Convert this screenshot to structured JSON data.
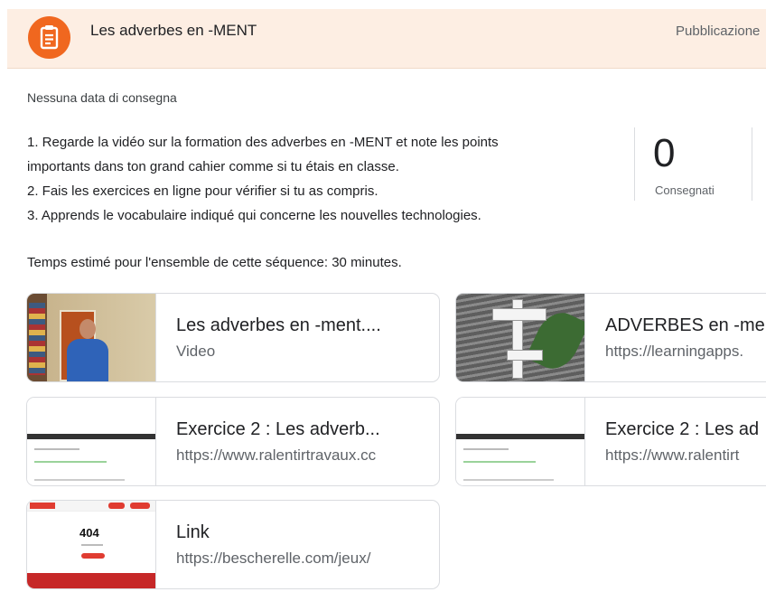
{
  "header": {
    "title": "Les adverbes en -MENT",
    "published_label": "Pubblicazione",
    "icon": "assignment-icon",
    "accent_color": "#f0671f",
    "background_color": "#fdeee3"
  },
  "due_text": "Nessuna data di consegna",
  "instructions": [
    "1. Regarde la vidéo sur la formation des adverbes en -MENT et note les points",
    "importants dans ton grand cahier comme si tu étais en classe.",
    "2. Fais les exercices en ligne pour vérifier si tu as compris.",
    "3. Apprends le vocabulaire indiqué qui concerne les nouvelles technologies."
  ],
  "estimate_text": "Temps estimé pour l'ensemble de cette séquence: 30 minutes.",
  "stats": {
    "turned_in_count": "0",
    "turned_in_label": "Consegnati"
  },
  "attachments": [
    {
      "title": "Les adverbes en -ment....",
      "subtitle": "Video"
    },
    {
      "title": "ADVERBES en -me",
      "subtitle": "https://learningapps."
    },
    {
      "title": "Exercice 2 : Les adverb...",
      "subtitle": "https://www.ralentirtravaux.cc"
    },
    {
      "title": "Exercice 2 : Les ad",
      "subtitle": "https://www.ralentirt"
    },
    {
      "title": "Link",
      "subtitle": "https://bescherelle.com/jeux/",
      "thumb_text": "404"
    }
  ]
}
